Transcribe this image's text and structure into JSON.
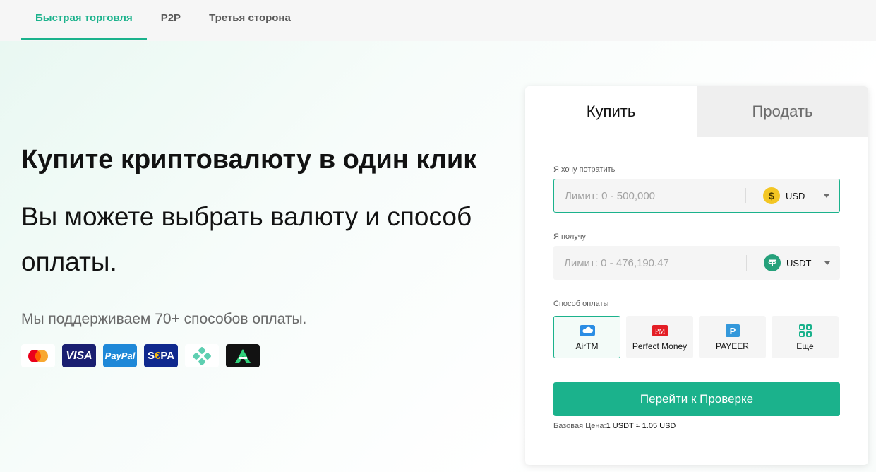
{
  "topnav": {
    "tabs": [
      {
        "label": "Быстрая торговля",
        "active": true
      },
      {
        "label": "P2P",
        "active": false
      },
      {
        "label": "Третья сторона",
        "active": false
      }
    ]
  },
  "hero": {
    "title": "Купите криптовалюту в один клик",
    "subtitle": "Вы можете выбрать валюту и способ оплаты.",
    "support_text": "Мы поддерживаем 70+ способов оплаты.",
    "logos": {
      "visa": "VISA",
      "paypal": "PayPal",
      "sepa_s": "S",
      "sepa_e": "€",
      "sepa_rest": "PA"
    }
  },
  "trade_card": {
    "tabs": {
      "buy": "Купить",
      "sell": "Продать"
    },
    "spend": {
      "label": "Я хочу потратить",
      "placeholder": "Лимит: 0 - 500,000",
      "currency": "USD",
      "currency_icon": "dollar-coin-icon"
    },
    "receive": {
      "label": "Я получу",
      "placeholder": "Лимит: 0 - 476,190.47",
      "currency": "USDT",
      "currency_icon": "tether-coin-icon"
    },
    "payment": {
      "label": "Способ оплаты",
      "methods": [
        {
          "label": "AirTM",
          "icon": "airtm-cloud-icon",
          "selected": true
        },
        {
          "label": "Perfect Money",
          "icon": "perfect-money-icon",
          "selected": false
        },
        {
          "label": "PAYEER",
          "icon": "payeer-icon",
          "selected": false
        },
        {
          "label": "Еще",
          "icon": "grid-more-icon",
          "selected": false
        }
      ]
    },
    "cta_label": "Перейти к Проверке",
    "base_price_label": "Базовая Цена:",
    "base_price_value": "1 USDT ≈ 1.05 USD"
  },
  "colors": {
    "accent": "#1bb28c",
    "text": "#121212",
    "muted": "#6a6a6a"
  }
}
